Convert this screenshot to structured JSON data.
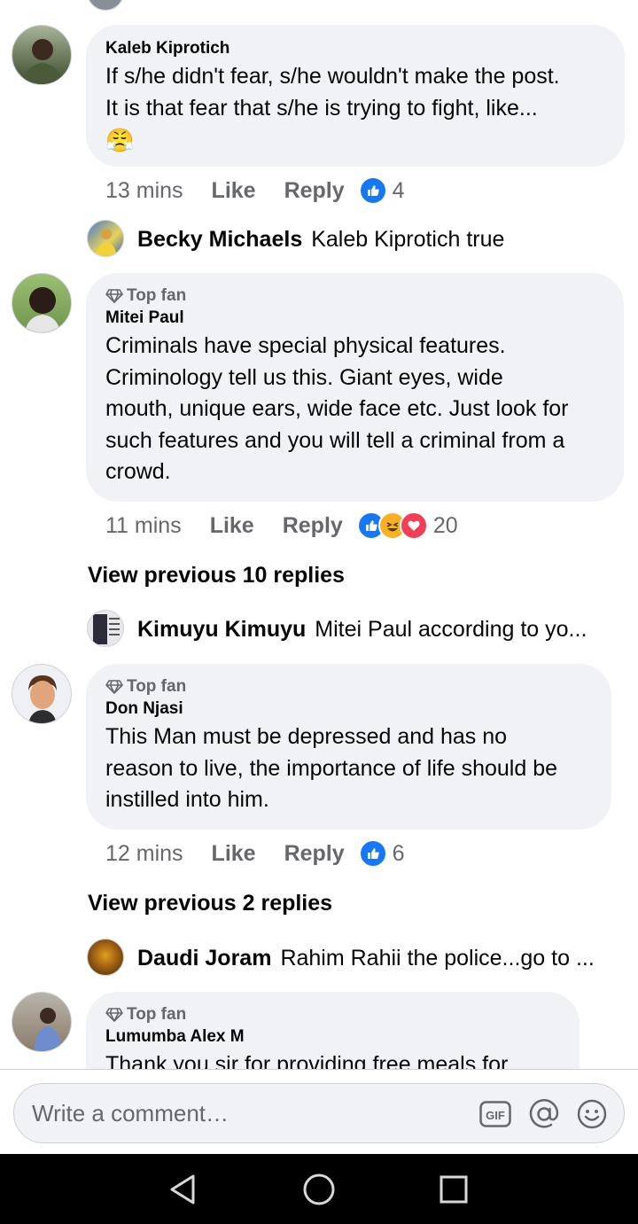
{
  "comments": [
    {
      "author": "Kaleb Kiprotich",
      "text_lines": [
        "If s/he didn't fear, s/he wouldn't make the post.",
        "It is that fear that s/he is trying to fight, like..."
      ],
      "emoji": "😤",
      "time": "13 mins",
      "like_label": "Like",
      "reply_label": "Reply",
      "reactions": [
        "like"
      ],
      "reaction_count": "4"
    },
    {
      "badge": "Top fan",
      "author": "Mitei Paul",
      "text_lines": [
        "Criminals have special physical features.",
        "Criminology tell us this. Giant eyes, wide",
        "mouth, unique ears, wide face etc. Just look for",
        "such features and you will tell a criminal from a",
        "crowd."
      ],
      "time": "11 mins",
      "like_label": "Like",
      "reply_label": "Reply",
      "reactions": [
        "like",
        "haha",
        "love"
      ],
      "reaction_count": "20"
    },
    {
      "badge": "Top fan",
      "author": "Don Njasi",
      "text_lines": [
        "This Man must be depressed and has no",
        "reason to live, the importance of life should be",
        "instilled into him."
      ],
      "time": "12 mins",
      "like_label": "Like",
      "reply_label": "Reply",
      "reactions": [
        "like"
      ],
      "reaction_count": "6"
    },
    {
      "badge": "Top fan",
      "author": "Lumumba Alex M",
      "text_lines": [
        "Thank you sir for providing free meals for"
      ]
    }
  ],
  "replies": [
    {
      "author": "Becky Michaels",
      "text": "Kaleb Kiprotich true"
    },
    {
      "author": "Kimuyu Kimuyu",
      "text": "Mitei Paul according to yo..."
    },
    {
      "author": "Daudi Joram",
      "text": "Rahim Rahii the police...go to ..."
    }
  ],
  "view_previous": [
    "View previous 10 replies",
    "View previous 2 replies"
  ],
  "composer": {
    "placeholder": "Write a comment…",
    "gif_label": "GIF",
    "icons": [
      "gif-icon",
      "mention-icon",
      "emoji-icon"
    ]
  },
  "navbar": {
    "icons": [
      "back-icon",
      "home-icon",
      "recents-icon"
    ]
  },
  "colors": {
    "like_blue": "#1877f2",
    "haha_yellow": "#f7b125",
    "love_red": "#f33e58",
    "bubble_bg": "#f0f2f5",
    "meta_gray": "#65676b"
  }
}
